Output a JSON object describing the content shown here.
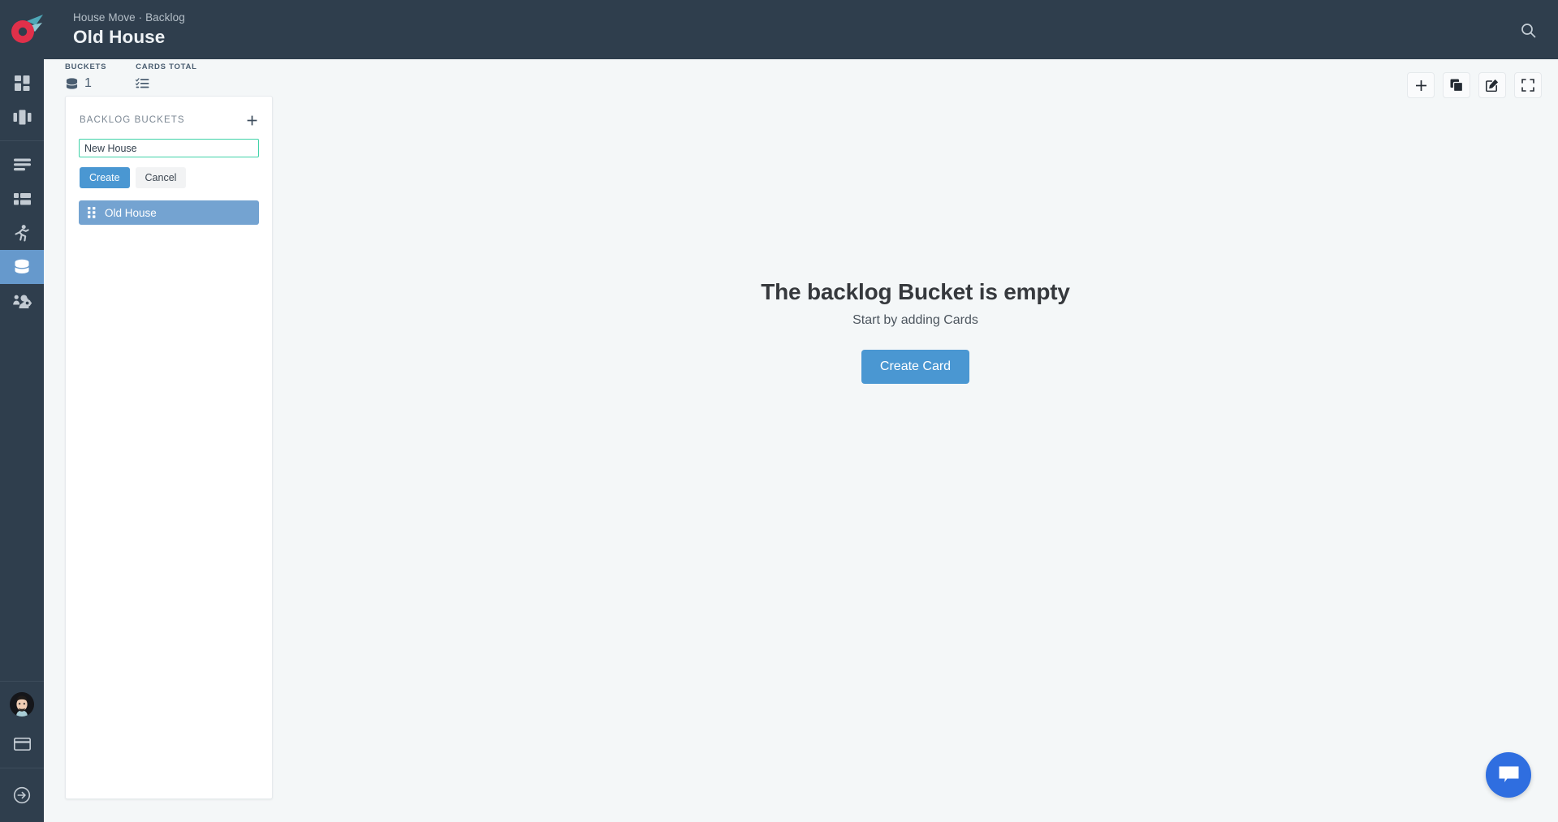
{
  "header": {
    "breadcrumb": "House Move · Backlog",
    "title": "Old House",
    "search_icon": "search-icon",
    "logo_colors": {
      "ring": "#e0304a",
      "leaf": "#4fa8b8",
      "leaf_light": "#8fc9d4"
    }
  },
  "sidebar": {
    "items": [
      {
        "name": "dashboard",
        "icon": "grid-dashboard-icon",
        "active": false
      },
      {
        "name": "boards",
        "icon": "kanban-columns-icon",
        "active": false
      },
      {
        "name": "lists",
        "icon": "list-lines-icon",
        "active": false
      },
      {
        "name": "table",
        "icon": "table-grid-icon",
        "active": false
      },
      {
        "name": "activity",
        "icon": "running-person-icon",
        "active": false
      },
      {
        "name": "backlog",
        "icon": "database-stack-icon",
        "active": true
      },
      {
        "name": "team-settings",
        "icon": "users-gear-icon",
        "active": false
      }
    ],
    "footer": [
      {
        "name": "profile",
        "icon": "avatar"
      },
      {
        "name": "billing",
        "icon": "credit-card-icon"
      },
      {
        "name": "logout",
        "icon": "arrow-circle-right-icon"
      }
    ],
    "active_color": "#6699cc",
    "background": "#2f3e4d"
  },
  "stats": [
    {
      "label": "BUCKETS",
      "icon": "database-stack-icon",
      "value": "1"
    },
    {
      "label": "CARDS TOTAL",
      "icon": "checklist-icon",
      "value": ""
    }
  ],
  "toolbar": {
    "buttons": [
      {
        "name": "add-button",
        "icon": "plus-icon"
      },
      {
        "name": "duplicate-button",
        "icon": "copy-stacked-squares-icon"
      },
      {
        "name": "edit-button",
        "icon": "pencil-square-icon"
      },
      {
        "name": "fullscreen-button",
        "icon": "expand-corners-icon"
      }
    ]
  },
  "panel": {
    "title": "BACKLOG BUCKETS",
    "add_icon": "plus-icon",
    "new_bucket": {
      "value": "New House",
      "placeholder": "",
      "focus_border": "#3fd2a8"
    },
    "create_label": "Create",
    "cancel_label": "Cancel",
    "buckets": [
      {
        "name": "Old House",
        "handle_icon": "drag-handle-dots-icon",
        "selected": true
      }
    ],
    "selected_color": "#74a3d1"
  },
  "empty_state": {
    "title": "The backlog Bucket is empty",
    "subtitle": "Start by adding Cards",
    "button_label": "Create Card",
    "button_color": "#4a97d2"
  },
  "chat": {
    "icon": "chat-bubble-icon",
    "color": "#2f6ee0"
  }
}
